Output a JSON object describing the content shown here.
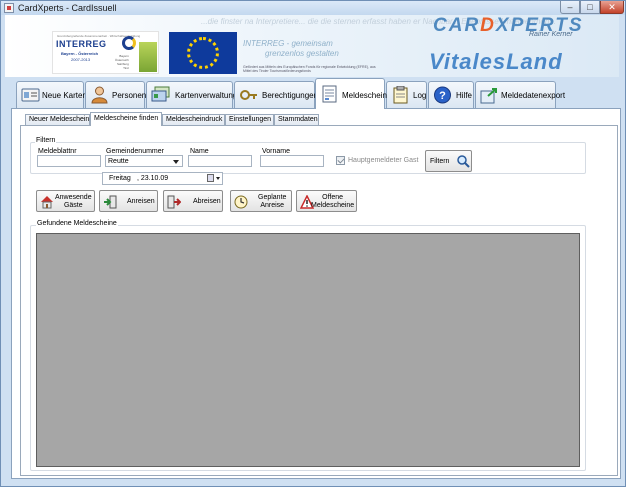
{
  "window": {
    "title": "CardXperts - CardIssuell"
  },
  "banner": {
    "ghost_text": "...die finster na Interpretiere... die die sternen erfasst haben er Nachbar... Erlebnisse Unternehmen...",
    "interreg_small": "Grenzübergreifende Zusammenarbeit · Wirtschaftsentwicklung",
    "interreg_title": "INTERREG",
    "interreg_sub": "Bayern - Österreich",
    "interreg_years": "2007-2013",
    "interreg_mini": "Bayern\nÖsterreich\nSalzburg\nTirol",
    "interreg_caption_line1": "INTERREG - gemeinsam",
    "interreg_caption_line2": "grenzenlos gestalten",
    "interreg_caption_small": "Gefördert aus Mitteln des Europäischen Fonds für regionale Entwicklung (EFRE), aus Mittel des Tiroler Tourismusförderungsfonds",
    "logo_card_a": "CAR",
    "logo_card_x": "D",
    "logo_card_b": "XPERTS",
    "logo_sub": "Rainer Kerner",
    "logo_vitales": "VitalesLand"
  },
  "main_tabs": [
    {
      "label": "Neue Karten",
      "icon": "card-icon"
    },
    {
      "label": "Personen",
      "icon": "person-icon"
    },
    {
      "label": "Kartenverwaltung",
      "icon": "cards-stack-icon"
    },
    {
      "label": "Berechtigungen",
      "icon": "key-icon"
    },
    {
      "label": "Meldeschein",
      "icon": "document-icon"
    },
    {
      "label": "Log",
      "icon": "clipboard-icon"
    },
    {
      "label": "Hilfe",
      "icon": "help-icon"
    },
    {
      "label": "Meldedatenexport",
      "icon": "export-icon"
    }
  ],
  "sub_tabs": [
    {
      "label": "Neuer Meldeschein"
    },
    {
      "label": "Meldescheine finden"
    },
    {
      "label": "Meldescheindruck"
    },
    {
      "label": "Einstellungen"
    },
    {
      "label": "Stammdaten"
    }
  ],
  "filter": {
    "group_title": "Filtern",
    "meldeblattnr_label": "Meldeblattnr",
    "meldeblattnr_value": "",
    "gemeindenummer_label": "Gemeindenummer",
    "gemeindenummer_value": "Reutte",
    "name_label": "Name",
    "name_value": "",
    "vorname_label": "Vorname",
    "vorname_value": "",
    "hauptgemeldet_label": "Hauptgemeldeter Gast",
    "hauptgemeldet_checked": true,
    "filter_button": "Filtern",
    "date_day": "Freitag",
    "date_value": ", 23.10.09"
  },
  "actions": [
    {
      "label": "Anwesende\nGäste",
      "icon": "house-icon"
    },
    {
      "label": "Anreisen",
      "icon": "arrive-icon"
    },
    {
      "label": "Abreisen",
      "icon": "depart-icon"
    },
    {
      "label": "Geplante\nAnreise",
      "icon": "clock-icon"
    },
    {
      "label": "Offene\nMeldescheine",
      "icon": "warning-icon"
    }
  ],
  "results": {
    "group_title": "Gefundene Meldescheine"
  }
}
